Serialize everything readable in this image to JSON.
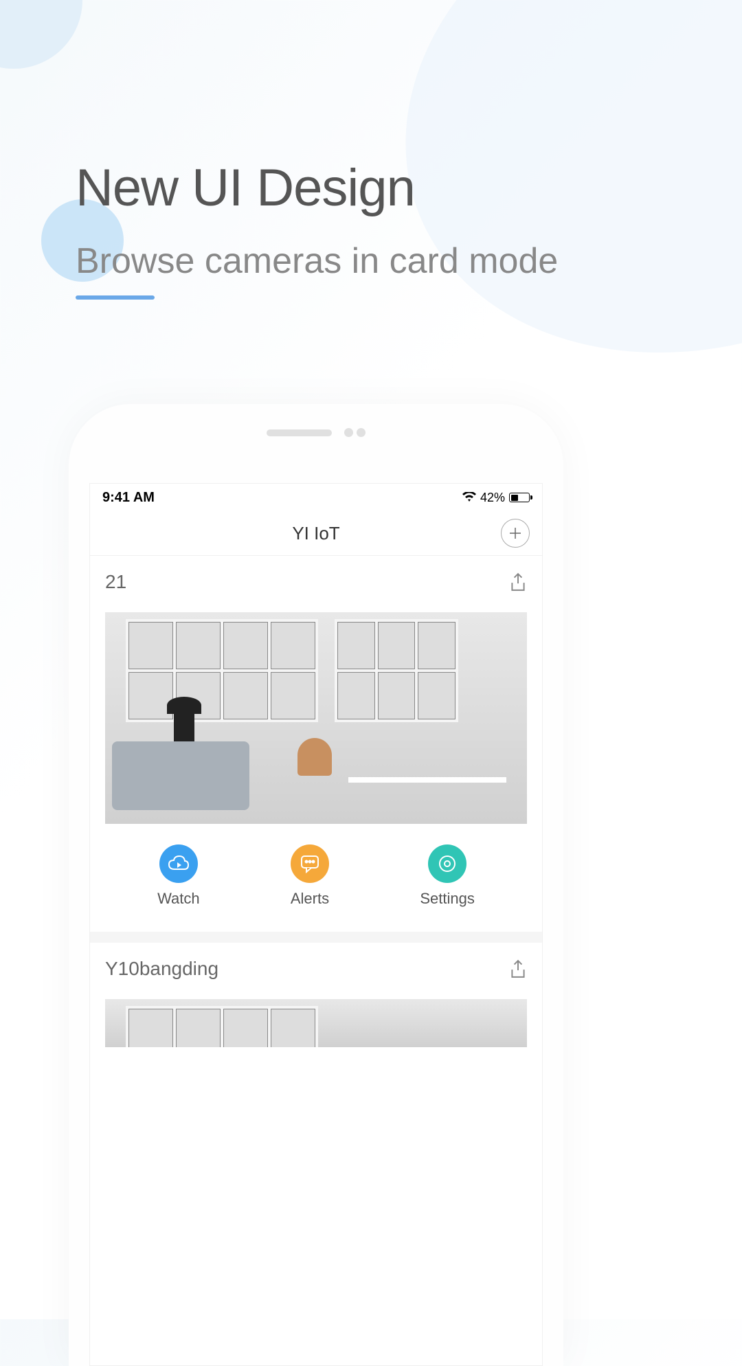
{
  "hero": {
    "title": "New UI Design",
    "subtitle": "Browse cameras in card mode"
  },
  "status": {
    "time": "9:41 AM",
    "battery_pct": "42%"
  },
  "app_header": {
    "title": "YI IoT"
  },
  "cards": [
    {
      "title": "21",
      "actions": {
        "watch": "Watch",
        "alerts": "Alerts",
        "settings": "Settings"
      }
    },
    {
      "title": "Y10bangding"
    }
  ]
}
